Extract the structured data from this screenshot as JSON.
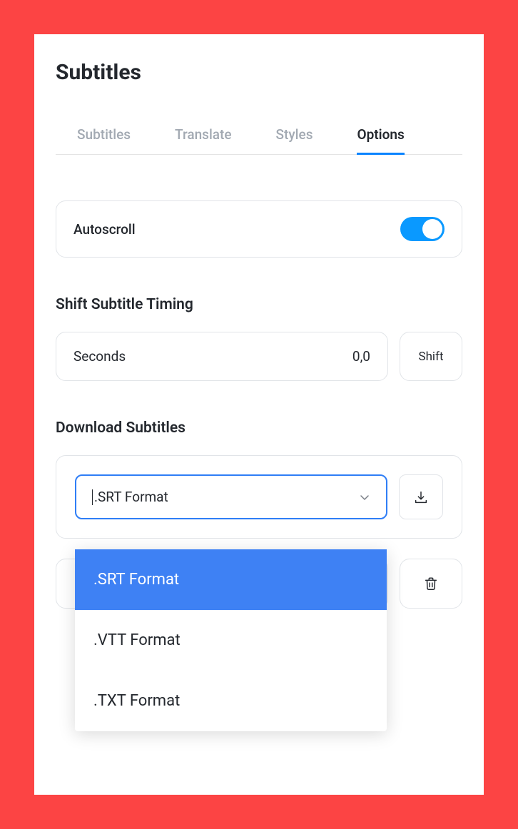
{
  "title": "Subtitles",
  "tabs": [
    {
      "label": "Subtitles",
      "active": false
    },
    {
      "label": "Translate",
      "active": false
    },
    {
      "label": "Styles",
      "active": false
    },
    {
      "label": "Options",
      "active": true
    }
  ],
  "autoscroll": {
    "label": "Autoscroll",
    "enabled": true
  },
  "shift": {
    "title": "Shift Subtitle Timing",
    "input_label": "Seconds",
    "value": "0,0",
    "button_label": "Shift"
  },
  "download": {
    "title": "Download Subtitles",
    "selected": ".SRT Format",
    "options": [
      ".SRT Format",
      ".VTT Format",
      ".TXT Format"
    ]
  }
}
